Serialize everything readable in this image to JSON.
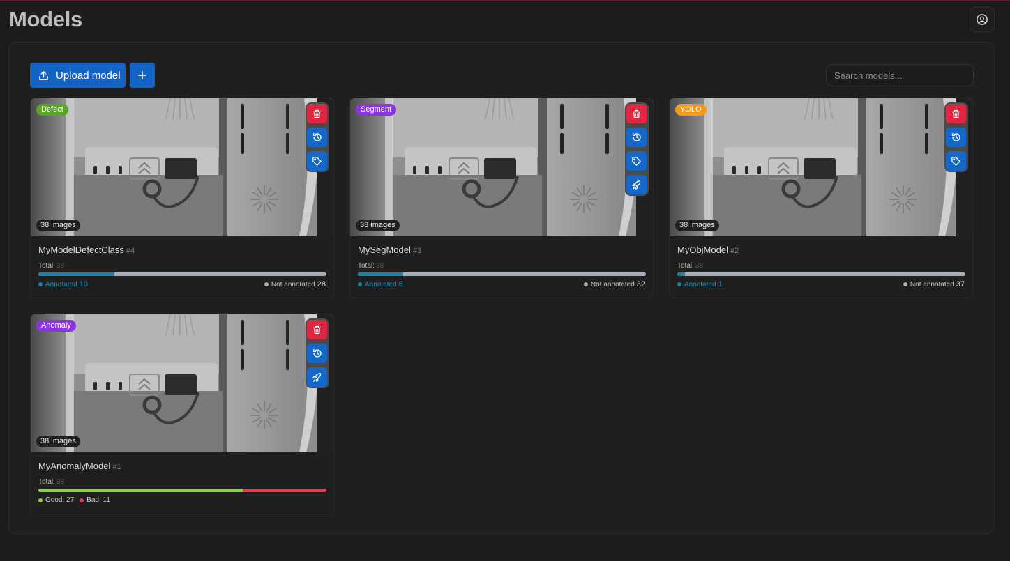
{
  "page": {
    "title": "Models"
  },
  "toolbar": {
    "upload_label": "Upload model",
    "search_placeholder": "Search models...",
    "search_value": ""
  },
  "colors": {
    "primary": "#1464c6",
    "danger": "#e02640",
    "annotated": "#1a82a5",
    "good": "#8ad33a",
    "bad": "#e8394d"
  },
  "models": [
    {
      "type": "Defect",
      "type_color": "#5aa524",
      "images_label": "38 images",
      "name": "MyModelDefectClass",
      "number": "#4",
      "total_label": "Total:",
      "total": "38",
      "annotated_label": "Annotated",
      "annotated": "10",
      "not_annotated_label": "Not annotated",
      "not_annotated": "28",
      "progress_fraction": 0.263,
      "actions": [
        "trash-icon",
        "history-icon",
        "tag-icon"
      ]
    },
    {
      "type": "Segment",
      "type_color": "#8b35e0",
      "images_label": "38 images",
      "name": "MySegModel",
      "number": "#3",
      "total_label": "Total:",
      "total": "38",
      "annotated_label": "Annotated",
      "annotated": "6",
      "not_annotated_label": "Not annotated",
      "not_annotated": "32",
      "progress_fraction": 0.158,
      "actions": [
        "trash-icon",
        "history-icon",
        "tag-icon",
        "rocket-icon"
      ]
    },
    {
      "type": "YOLO",
      "type_color": "#f29a1e",
      "images_label": "38 images",
      "name": "MyObjModel",
      "number": "#2",
      "total_label": "Total:",
      "total": "38",
      "annotated_label": "Annotated",
      "annotated": "1",
      "not_annotated_label": "Not annotated",
      "not_annotated": "37",
      "progress_fraction": 0.026,
      "actions": [
        "trash-icon",
        "history-icon",
        "tag-icon"
      ]
    },
    {
      "type": "Anomaly",
      "type_color": "#8b35e0",
      "images_label": "38 images",
      "name": "MyAnomalyModel",
      "number": "#1",
      "total_label": "Total:",
      "total": "38",
      "good_label": "Good: 27",
      "bad_label": "Bad: 11",
      "progress_fraction": 0.71,
      "actions": [
        "trash-icon",
        "history-icon",
        "rocket-icon"
      ]
    }
  ]
}
